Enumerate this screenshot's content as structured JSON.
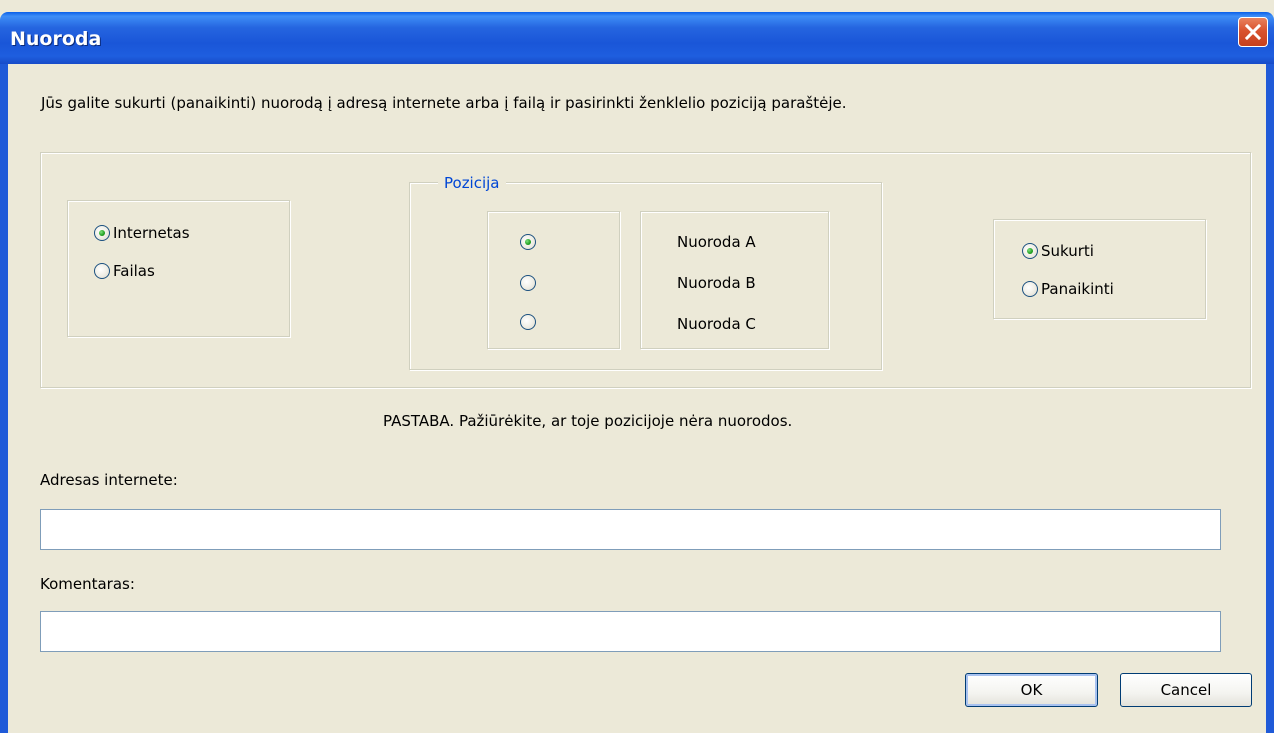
{
  "window": {
    "title": "Nuoroda",
    "close_icon": "close-icon"
  },
  "intro_text": "Jūs galite sukurti (panaikinti)  nuorodą į adresą internete arba į failą ir pasirinkti ženklelio poziciją paraštėje.",
  "source_group": {
    "options": [
      {
        "label": "Internetas",
        "checked": true
      },
      {
        "label": "Failas",
        "checked": false
      }
    ]
  },
  "position_group": {
    "legend": "Pozicija",
    "options": [
      {
        "label": "Nuoroda A",
        "checked": true
      },
      {
        "label": "Nuoroda B",
        "checked": false
      },
      {
        "label": "Nuoroda C",
        "checked": false
      }
    ]
  },
  "action_group": {
    "options": [
      {
        "label": "Sukurti",
        "checked": true
      },
      {
        "label": "Panaikinti",
        "checked": false
      }
    ]
  },
  "note": "PASTABA. Pažiūrėkite, ar toje pozicijoje nėra nuorodos.",
  "address_field": {
    "label": "Adresas internete:",
    "value": ""
  },
  "comment_field": {
    "label": "Komentaras:",
    "value": ""
  },
  "buttons": {
    "ok": "OK",
    "cancel": "Cancel"
  },
  "colors": {
    "title_bar": "#1F5AD8",
    "dialog_bg": "#ECE9D8",
    "legend_text": "#0046D5",
    "close_button": "#D9532E",
    "radio_selected": "#21A121"
  }
}
